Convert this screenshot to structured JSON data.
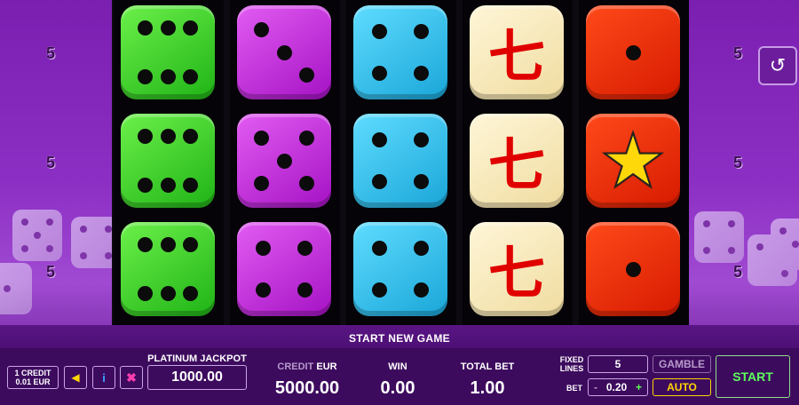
{
  "lines": {
    "left": [
      "5",
      "5",
      "5"
    ],
    "right": [
      "5",
      "5",
      "5"
    ]
  },
  "reels": [
    {
      "color": "green",
      "symbols": [
        6,
        6,
        6
      ]
    },
    {
      "color": "purple",
      "symbols": [
        3,
        5,
        4
      ]
    },
    {
      "color": "cyan",
      "symbols": [
        4,
        4,
        4
      ]
    },
    {
      "color": "cream",
      "symbols": [
        "七",
        "七",
        "七"
      ]
    },
    {
      "color": "red",
      "symbols": [
        1,
        "★",
        1
      ]
    }
  ],
  "top_bar": {
    "start_new_game": "START NEW GAME"
  },
  "bottom": {
    "credit_denom_1": "1 CREDIT",
    "credit_denom_2": "0.01 EUR",
    "jackpot_label": "PLATINUM JACKPOT",
    "jackpot_value": "1000.00",
    "credit_label": "CREDIT",
    "credit_currency": "EUR",
    "credit_value": "5000.00",
    "win_label": "WIN",
    "win_value": "0.00",
    "total_bet_label": "TOTAL BET",
    "total_bet_value": "1.00",
    "fixed_lines_label_1": "FIXED",
    "fixed_lines_label_2": "LINES",
    "lines_value": "5",
    "bet_label": "BET",
    "bet_minus": "-",
    "bet_value": "0.20",
    "bet_plus": "+",
    "gamble_label": "GAMBLE",
    "auto_label": "AUTO",
    "start_label": "START"
  },
  "icons": {
    "sound": "speaker-icon",
    "info": "info-icon",
    "settings": "cross-icon",
    "history": "history-icon"
  }
}
